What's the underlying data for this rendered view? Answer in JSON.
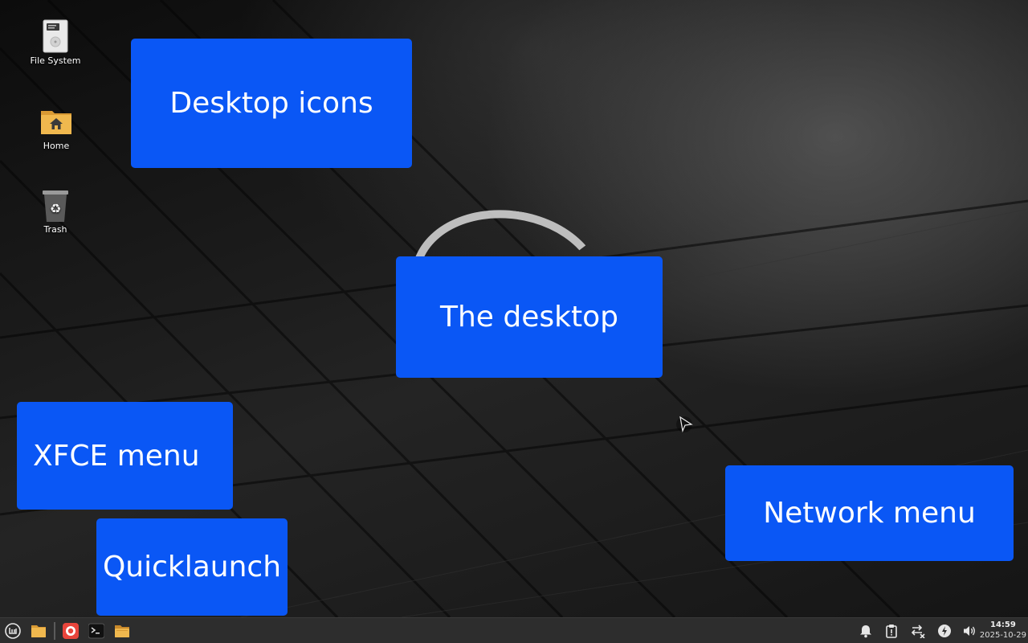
{
  "desktop_icons": [
    {
      "label": "File System",
      "icon": "drive-harddisk-icon"
    },
    {
      "label": "Home",
      "icon": "home-folder-icon"
    },
    {
      "label": "Trash",
      "icon": "trash-icon"
    }
  ],
  "callouts": {
    "desktop_icons": "Desktop icons",
    "the_desktop": "The desktop",
    "xfce_menu": "XFCE menu",
    "quicklaunch": "Quicklaunch",
    "network_menu": "Network menu"
  },
  "panel": {
    "launchers": [
      "mint-menu-icon",
      "folder-icon",
      "firefox-icon",
      "terminal-icon",
      "file-manager-icon"
    ],
    "tray": [
      "notification-bell-icon",
      "clipboard-icon",
      "network-disconnected-icon",
      "power-icon",
      "volume-icon"
    ],
    "clock": {
      "time": "14:59",
      "date": "2025-10-29"
    }
  },
  "colors": {
    "callout": "#0a57f5",
    "panel": "#2d2d2d",
    "folder": "#f0b84e"
  }
}
